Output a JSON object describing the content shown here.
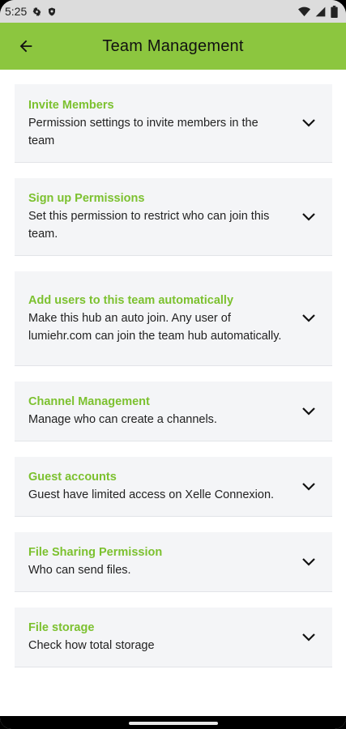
{
  "status_bar": {
    "time": "5:25"
  },
  "app_bar": {
    "title": "Team Management"
  },
  "sections": [
    {
      "title": "Invite Members",
      "description": "Permission settings to invite members in the team"
    },
    {
      "title": "Sign up Permissions",
      "description": "Set this permission to restrict who can join this team."
    },
    {
      "title": "Add users to this team automatically",
      "description": "Make this hub an auto join. Any user of lumiehr.com can join the team hub automatically."
    },
    {
      "title": "Channel Management",
      "description": "Manage who can create a channels."
    },
    {
      "title": "Guest accounts",
      "description": "Guest have limited access on Xelle Connexion."
    },
    {
      "title": "File Sharing Permission",
      "description": "Who can send files."
    },
    {
      "title": "File storage",
      "description": "Check how total storage"
    }
  ],
  "colors": {
    "app_bar": "#8cc63f",
    "section_title": "#7cc12f",
    "card_bg": "#f4f5f7"
  },
  "icons": {
    "back": "arrow-left-icon",
    "expand": "chevron-down-icon"
  }
}
